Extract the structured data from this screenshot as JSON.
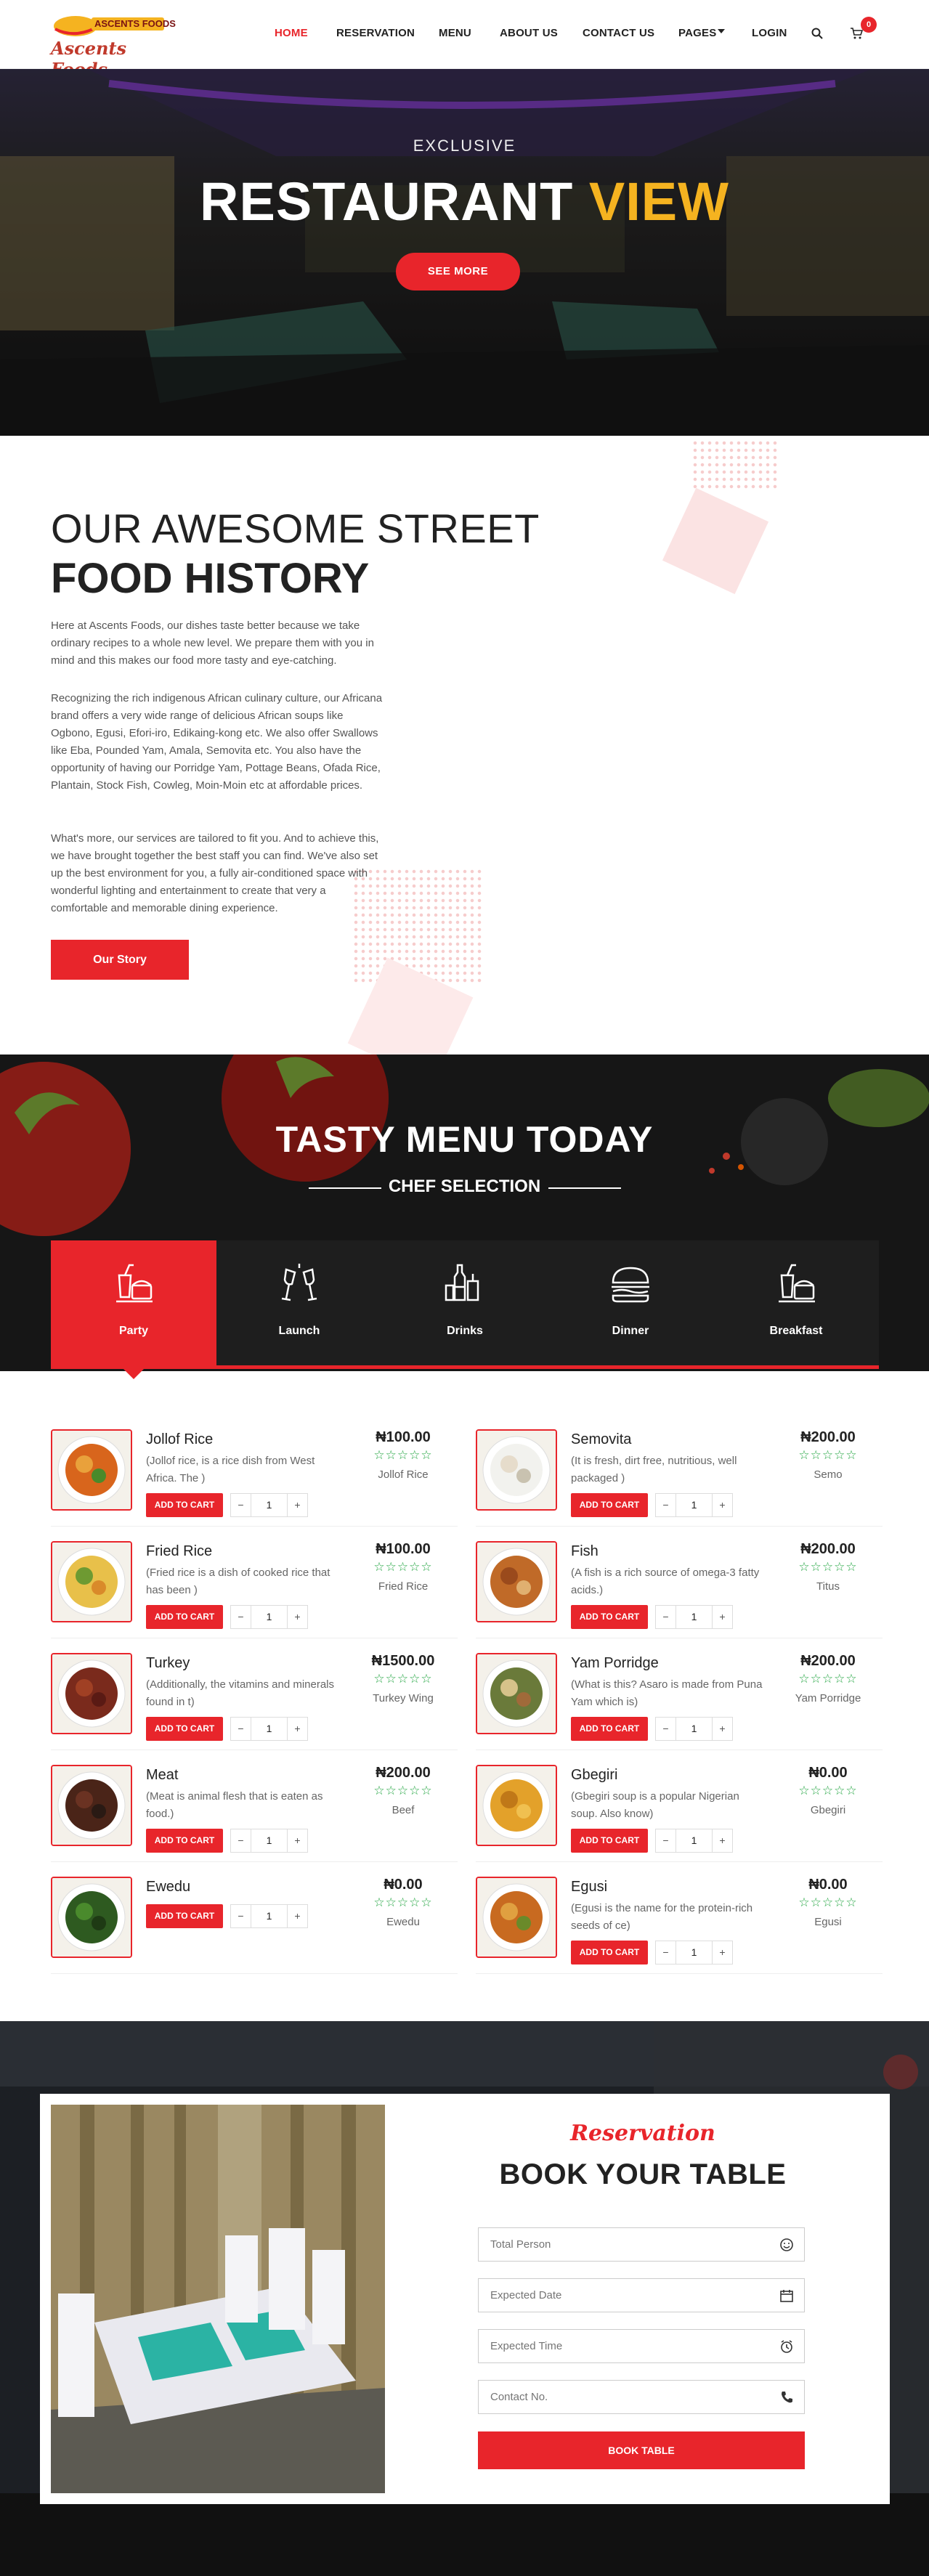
{
  "header": {
    "logo_top": "ASCENTS FOODS",
    "logo_script": "Ascents Foods",
    "nav": [
      "HOME",
      "RESERVATION",
      "MENU",
      "ABOUT US",
      "CONTACT US",
      "PAGES",
      "LOGIN"
    ],
    "cart_count": "0",
    "icons": [
      "search-icon",
      "cart-icon",
      "caret-down-icon"
    ]
  },
  "hero": {
    "kicker": "EXCLUSIVE",
    "title_part1": "RESTAURANT ",
    "title_part2": "VIEW",
    "button": "SEE MORE"
  },
  "history": {
    "line1": "OUR AWESOME STREET",
    "line2": "FOOD HISTORY",
    "p1": "Here at Ascents Foods, our dishes taste better because we take ordinary recipes to a whole new level. We prepare them with you in mind and this makes our food more tasty and eye-catching.",
    "p2": "Recognizing the rich indigenous African culinary culture, our Africana brand offers a very wide range of delicious African soups like Ogbono, Egusi, Efori-iro, Edikaing-kong etc. We also offer Swallows like Eba, Pounded Yam, Amala, Semovita etc. You also have the opportunity of having our Porridge Yam, Pottage Beans, Ofada Rice, Plantain, Stock Fish, Cowleg, Moin-Moin etc at affordable prices.",
    "p3": "What's more, our services are tailored to fit you. And to achieve this, we have brought together the best staff you can find. We've also set up the best environment for you, a fully air-conditioned space with wonderful lighting and entertainment to create that very a comfortable and memorable dining experience.",
    "button": "Our Story"
  },
  "menu": {
    "title": "TASTY MENU TODAY",
    "subtitle": "CHEF SELECTION",
    "tabs": [
      "Party",
      "Launch",
      "Drinks",
      "Dinner",
      "Breakfast"
    ],
    "active_tab": "Party",
    "add_label": "ADD TO CART",
    "qty_minus": "−",
    "qty_plus": "+",
    "stars": "☆☆☆☆☆",
    "items": [
      {
        "name": "Jollof Rice",
        "desc": "(Jollof rice, is a rice dish from West Africa. The )",
        "price": "₦100.00",
        "cat": "Jollof Rice",
        "qty": "1"
      },
      {
        "name": "Semovita",
        "desc": "(It is fresh, dirt free, nutritious, well packaged )",
        "price": "₦200.00",
        "cat": "Semo",
        "qty": "1"
      },
      {
        "name": "Fried Rice",
        "desc": "(Fried rice is a dish of cooked rice that has been )",
        "price": "₦100.00",
        "cat": "Fried Rice",
        "qty": "1"
      },
      {
        "name": "Fish",
        "desc": "(A fish is a rich source of omega-3 fatty acids.)",
        "price": "₦200.00",
        "cat": "Titus",
        "qty": "1"
      },
      {
        "name": "Turkey",
        "desc": "(Additionally, the vitamins and minerals found in t)",
        "price": "₦1500.00",
        "cat": "Turkey Wing",
        "qty": "1"
      },
      {
        "name": "Yam Porridge",
        "desc": "(What is this? Asaro is made from Puna Yam which is)",
        "price": "₦200.00",
        "cat": "Yam Porridge",
        "qty": "1"
      },
      {
        "name": "Meat",
        "desc": "(Meat is animal flesh that is eaten as food.)",
        "price": "₦200.00",
        "cat": "Beef",
        "qty": "1"
      },
      {
        "name": "Gbegiri",
        "desc": "(Gbegiri soup is a popular Nigerian soup. Also know)",
        "price": "₦0.00",
        "cat": "Gbegiri",
        "qty": "1"
      },
      {
        "name": "Ewedu",
        "desc": "",
        "price": "₦0.00",
        "cat": "Ewedu",
        "qty": "1"
      },
      {
        "name": "Egusi",
        "desc": "(Egusi is the name for the protein-rich seeds of ce)",
        "price": "₦0.00",
        "cat": "Egusi",
        "qty": "1"
      }
    ]
  },
  "reservation": {
    "script": "Reservation",
    "title": "BOOK YOUR TABLE",
    "fields": [
      {
        "placeholder": "Total Person",
        "icon": "smile-icon"
      },
      {
        "placeholder": "Expected Date",
        "icon": "calendar-icon"
      },
      {
        "placeholder": "Expected Time",
        "icon": "alarm-clock-icon"
      },
      {
        "placeholder": "Contact No.",
        "icon": "phone-icon"
      }
    ],
    "button": "BOOK TABLE"
  },
  "colors": {
    "accent": "#e8252b",
    "highlight": "#f5b320",
    "dark": "#1e1e1e",
    "stars": "#27a745"
  }
}
